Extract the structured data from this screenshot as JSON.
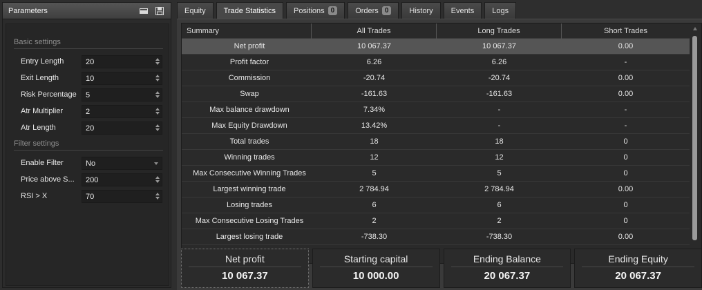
{
  "parameters": {
    "title": "Parameters",
    "sections": [
      {
        "title": "Basic settings",
        "fields": [
          {
            "label": "Entry Length",
            "value": "20",
            "type": "number"
          },
          {
            "label": "Exit Length",
            "value": "10",
            "type": "number"
          },
          {
            "label": "Risk Percentage",
            "value": "5",
            "type": "number"
          },
          {
            "label": "Atr Multiplier",
            "value": "2",
            "type": "number"
          },
          {
            "label": "Atr Length",
            "value": "20",
            "type": "number"
          }
        ]
      },
      {
        "title": "Filter settings",
        "fields": [
          {
            "label": "Enable Filter",
            "value": "No",
            "type": "select"
          },
          {
            "label": "Price above S...",
            "value": "200",
            "type": "number"
          },
          {
            "label": "RSI > X",
            "value": "70",
            "type": "number"
          }
        ]
      }
    ]
  },
  "tabs": [
    {
      "label": "Equity"
    },
    {
      "label": "Trade Statistics",
      "active": true
    },
    {
      "label": "Positions",
      "badge": "0"
    },
    {
      "label": "Orders",
      "badge": "0"
    },
    {
      "label": "History"
    },
    {
      "label": "Events"
    },
    {
      "label": "Logs"
    }
  ],
  "table": {
    "headers": [
      "Summary",
      "All Trades",
      "Long Trades",
      "Short Trades"
    ],
    "rows": [
      [
        "Net profit",
        "10 067.37",
        "10 067.37",
        "0.00"
      ],
      [
        "Profit factor",
        "6.26",
        "6.26",
        "-"
      ],
      [
        "Commission",
        "-20.74",
        "-20.74",
        "0.00"
      ],
      [
        "Swap",
        "-161.63",
        "-161.63",
        "0.00"
      ],
      [
        "Max balance drawdown",
        "7.34%",
        "-",
        "-"
      ],
      [
        "Max Equity Drawdown",
        "13.42%",
        "-",
        "-"
      ],
      [
        "Total trades",
        "18",
        "18",
        "0"
      ],
      [
        "Winning trades",
        "12",
        "12",
        "0"
      ],
      [
        "Max Consecutive Winning Trades",
        "5",
        "5",
        "0"
      ],
      [
        "Largest winning trade",
        "2 784.94",
        "2 784.94",
        "0.00"
      ],
      [
        "Losing trades",
        "6",
        "6",
        "0"
      ],
      [
        "Max Consecutive Losing Trades",
        "2",
        "2",
        "0"
      ],
      [
        "Largest losing trade",
        "-738.30",
        "-738.30",
        "0.00"
      ]
    ],
    "selected_row": 0
  },
  "summary_cards": [
    {
      "label": "Net profit",
      "value": "10 067.37"
    },
    {
      "label": "Starting capital",
      "value": "10 000.00"
    },
    {
      "label": "Ending Balance",
      "value": "20 067.37"
    },
    {
      "label": "Ending Equity",
      "value": "20 067.37"
    }
  ],
  "colors": {
    "background": "#2e2e2e",
    "panel": "#262626",
    "selected_row": "#555555"
  }
}
